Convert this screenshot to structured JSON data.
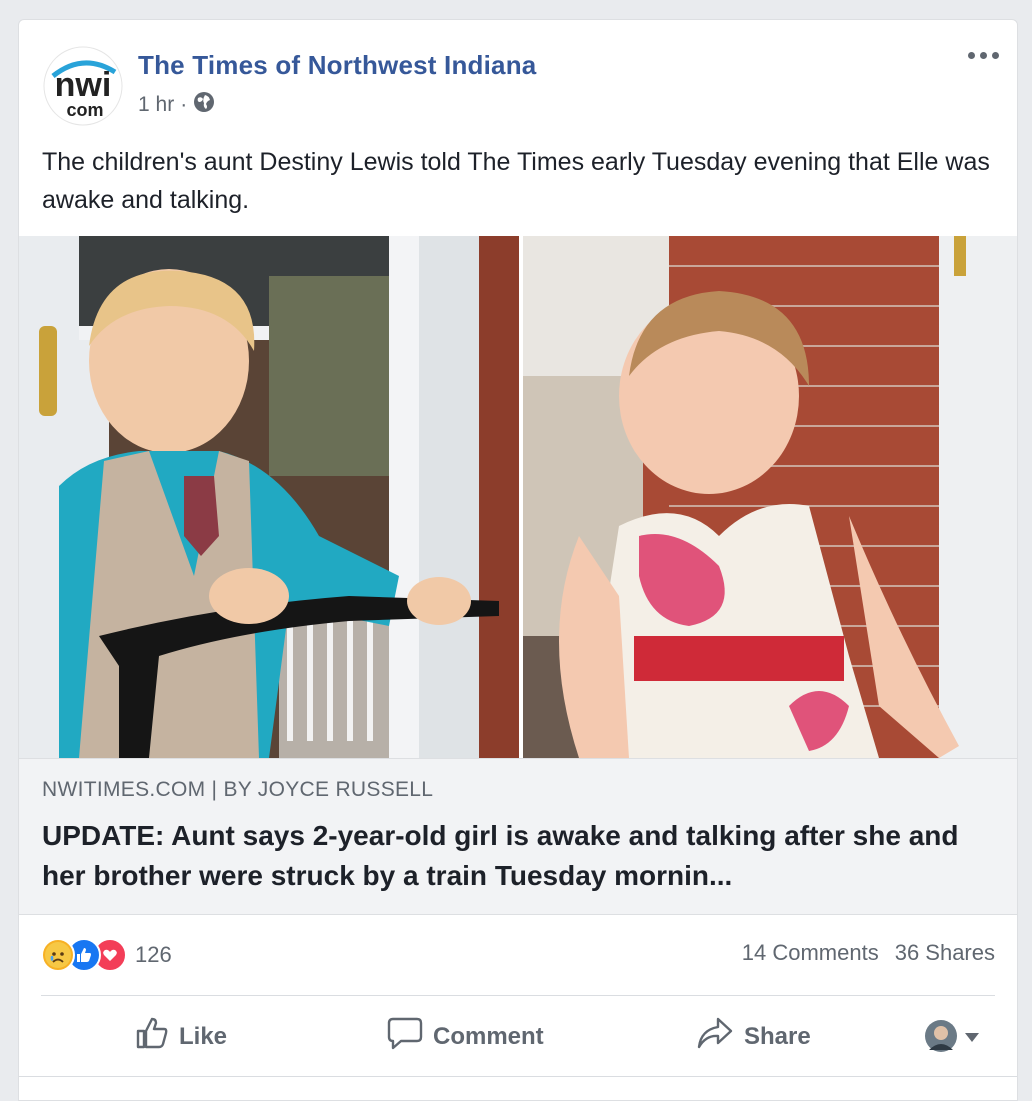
{
  "post": {
    "page_name": "The Times of Northwest Indiana",
    "time": "1 hr",
    "separator": "·",
    "logo_text": {
      "top": "nwi",
      "bottom": "com"
    },
    "body_text": "The children's aunt Destiny Lewis told The Times early Tuesday evening that Elle was awake and talking."
  },
  "link_preview": {
    "source": "NWITIMES.COM | BY JOYCE RUSSELL",
    "headline": "UPDATE: Aunt says 2-year-old girl is awake and talking after she and her brother were struck by a train Tuesday mornin..."
  },
  "stats": {
    "reaction_count": "126",
    "comments": "14 Comments",
    "shares": "36 Shares",
    "reactions": [
      "sad",
      "like",
      "love"
    ]
  },
  "actions": {
    "like": "Like",
    "comment": "Comment",
    "share": "Share"
  },
  "colors": {
    "link_blue": "#365899",
    "like_blue": "#1877f2",
    "love_red": "#f33e58",
    "sad_yellow": "#f7b125",
    "muted": "#606770"
  }
}
